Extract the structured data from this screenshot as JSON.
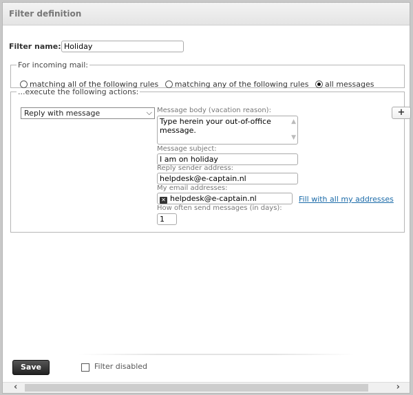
{
  "header": {
    "title": "Filter definition"
  },
  "filter_name": {
    "label": "Filter name:",
    "value": "Holiday"
  },
  "incoming": {
    "legend": "For incoming mail:",
    "options": [
      {
        "label": "matching all of the following rules",
        "selected": false
      },
      {
        "label": "matching any of the following rules",
        "selected": false
      },
      {
        "label": "all messages",
        "selected": true
      }
    ]
  },
  "actions": {
    "legend": "...execute the following actions:",
    "action_select": "Reply with message",
    "add_label": "+",
    "body_label": "Message body (vacation reason):",
    "body_value_line1": "Type herein your out-of-office",
    "body_value_line2": "message.",
    "subject_label": "Message subject:",
    "subject_value": "I am on holiday",
    "sender_label": "Reply sender address:",
    "sender_value": "helpdesk@e-captain.nl",
    "my_addresses_label": "My email addresses:",
    "my_address_value": "helpdesk@e-captain.nl",
    "fill_link": "Fill with all my addresses",
    "frequency_label": "How often send messages (in days):",
    "frequency_value": "1"
  },
  "footer": {
    "save_label": "Save",
    "disabled_label": "Filter disabled",
    "disabled_checked": false
  }
}
